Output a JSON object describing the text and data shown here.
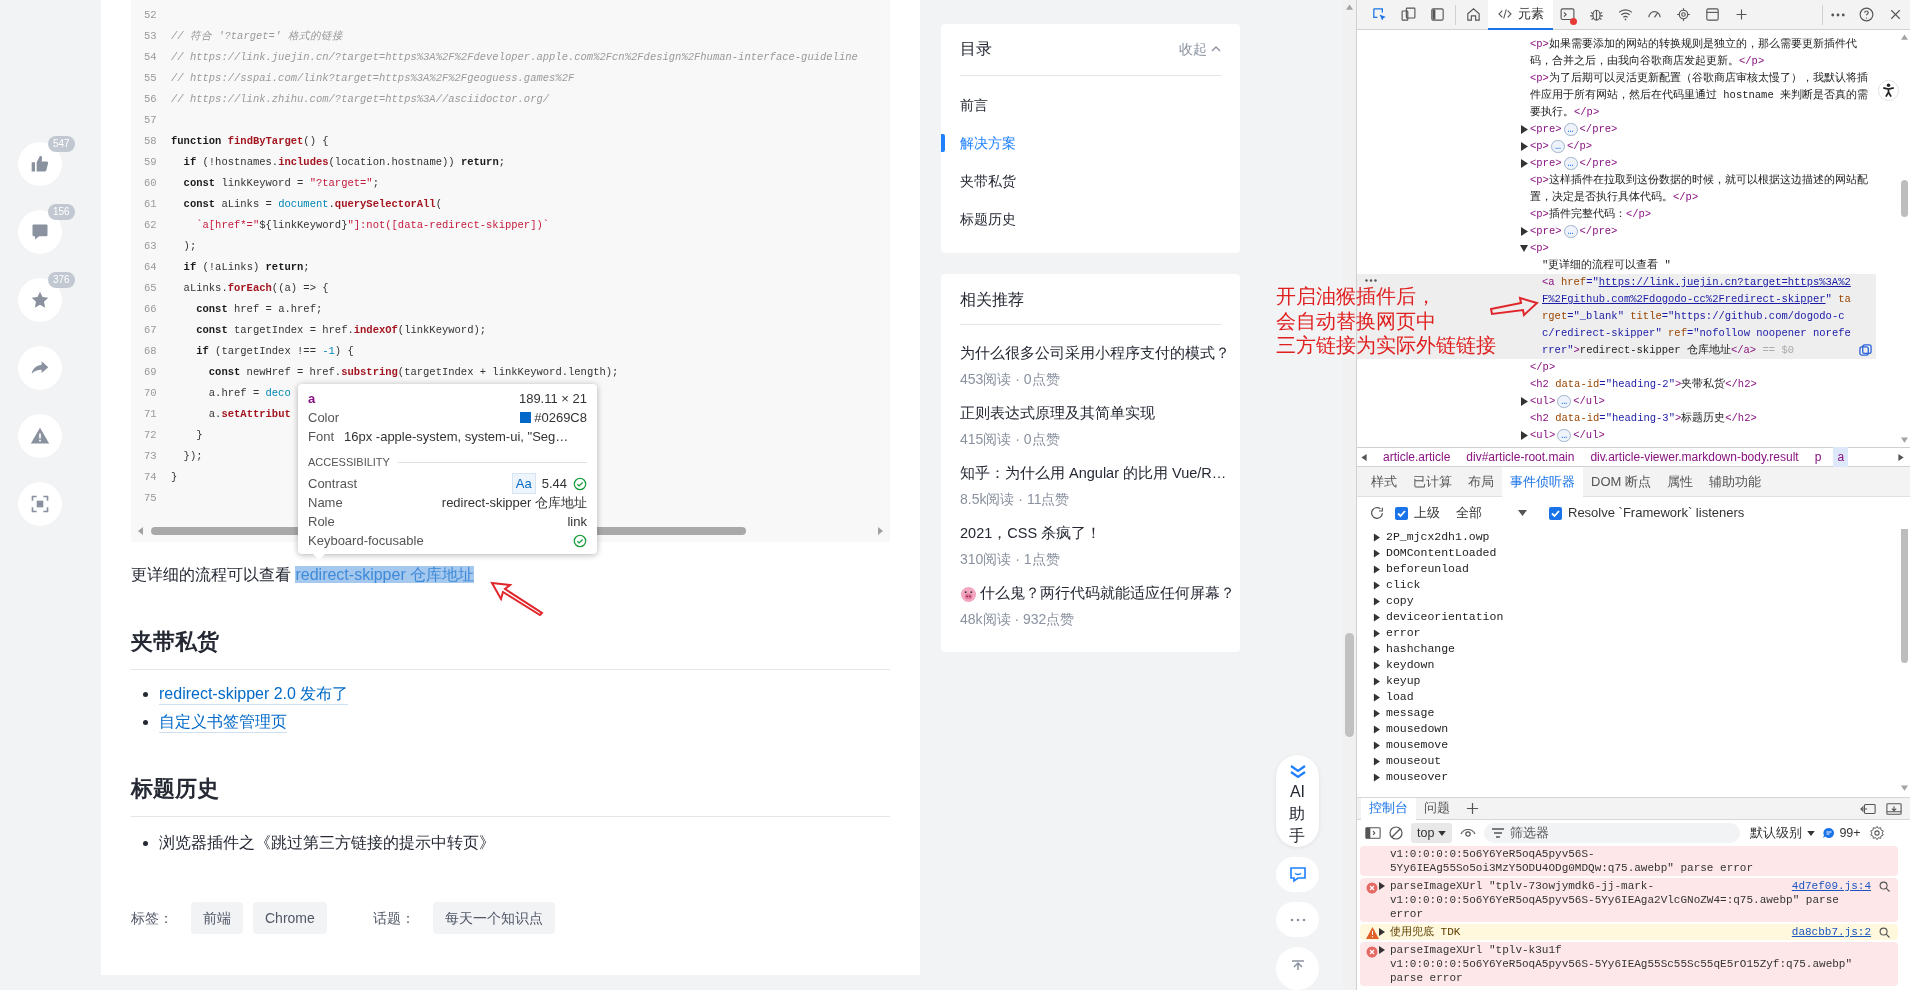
{
  "sidebar_actions": [
    {
      "kind": "like",
      "count": "547"
    },
    {
      "kind": "comment",
      "count": "156"
    },
    {
      "kind": "star",
      "count": "376"
    },
    {
      "kind": "share"
    },
    {
      "kind": "report"
    },
    {
      "kind": "fullscreen"
    }
  ],
  "code_block": {
    "lines": [
      {
        "number": "52"
      },
      {
        "number": "53",
        "tokens": [
          {
            "kind": "comment",
            "text": "// 符合 '?target=' 格式的链接"
          }
        ]
      },
      {
        "number": "54",
        "tokens": [
          {
            "kind": "comment",
            "text": "// https://link.juejin.cn/?target=https%3A%2F%2Fdeveloper.apple.com%2Fcn%2Fdesign%2Fhuman-interface-guideline"
          }
        ]
      },
      {
        "number": "55",
        "tokens": [
          {
            "kind": "comment",
            "text": "// https://sspai.com/link?target=https%3A%2F%2Fgeoguess.games%2F"
          }
        ]
      },
      {
        "number": "56",
        "tokens": [
          {
            "kind": "comment",
            "text": "// https://link.zhihu.com/?target=https%3A//asciidoctor.org/"
          }
        ]
      },
      {
        "number": "57"
      },
      {
        "number": "58",
        "tokens": [
          {
            "kind": "kw",
            "text": "function"
          },
          {
            "kind": "fn",
            "text": " findByTarget"
          },
          {
            "kind": "plain",
            "text": "() {"
          }
        ]
      },
      {
        "number": "59",
        "tokens": [
          {
            "kind": "kw",
            "text": "  if"
          },
          {
            "kind": "plain",
            "text": " (!hostnames."
          },
          {
            "kind": "fn",
            "text": "includes"
          },
          {
            "kind": "plain",
            "text": "(location.hostname)) "
          },
          {
            "kind": "kw",
            "text": "return"
          },
          {
            "kind": "plain",
            "text": ";"
          }
        ]
      },
      {
        "number": "60",
        "tokens": [
          {
            "kind": "kw",
            "text": "  const"
          },
          {
            "kind": "plain",
            "text": " linkKeyword = "
          },
          {
            "kind": "str",
            "text": "\"?target=\""
          },
          {
            "kind": "plain",
            "text": ";"
          }
        ]
      },
      {
        "number": "61",
        "tokens": [
          {
            "kind": "kw",
            "text": "  const"
          },
          {
            "kind": "plain",
            "text": " aLinks = "
          },
          {
            "kind": "builtin",
            "text": "document"
          },
          {
            "kind": "plain",
            "text": "."
          },
          {
            "kind": "fn",
            "text": "querySelectorAll"
          },
          {
            "kind": "plain",
            "text": "("
          }
        ]
      },
      {
        "number": "62",
        "tokens": [
          {
            "kind": "str",
            "text": "    `a[href*=\""
          },
          {
            "kind": "plain",
            "text": "${linkKeyword}"
          },
          {
            "kind": "str",
            "text": "\"]:not([data-redirect-skipper])`"
          }
        ]
      },
      {
        "number": "63",
        "tokens": [
          {
            "kind": "plain",
            "text": "  );"
          }
        ]
      },
      {
        "number": "64",
        "tokens": [
          {
            "kind": "kw",
            "text": "  if"
          },
          {
            "kind": "plain",
            "text": " (!aLinks) "
          },
          {
            "kind": "kw",
            "text": "return"
          },
          {
            "kind": "plain",
            "text": ";"
          }
        ]
      },
      {
        "number": "65",
        "tokens": [
          {
            "kind": "plain",
            "text": "  aLinks."
          },
          {
            "kind": "fn",
            "text": "forEach"
          },
          {
            "kind": "plain",
            "text": "((a) => {"
          }
        ]
      },
      {
        "number": "66",
        "tokens": [
          {
            "kind": "kw",
            "text": "    const"
          },
          {
            "kind": "plain",
            "text": " href = a.href;"
          }
        ]
      },
      {
        "number": "67",
        "tokens": [
          {
            "kind": "kw",
            "text": "    const"
          },
          {
            "kind": "plain",
            "text": " targetIndex = href."
          },
          {
            "kind": "fn",
            "text": "indexOf"
          },
          {
            "kind": "plain",
            "text": "(linkKeyword);"
          }
        ]
      },
      {
        "number": "68",
        "tokens": [
          {
            "kind": "kw",
            "text": "    if"
          },
          {
            "kind": "plain",
            "text": " (targetIndex !== "
          },
          {
            "kind": "builtin",
            "text": "-1"
          },
          {
            "kind": "plain",
            "text": ") {"
          }
        ]
      },
      {
        "number": "69",
        "tokens": [
          {
            "kind": "kw",
            "text": "      const"
          },
          {
            "kind": "plain",
            "text": " newHref = href."
          },
          {
            "kind": "fn",
            "text": "substring"
          },
          {
            "kind": "plain",
            "text": "(targetIndex + linkKeyword.length);"
          }
        ]
      },
      {
        "number": "70",
        "tokens": [
          {
            "kind": "plain",
            "text": "      a.href = "
          },
          {
            "kind": "builtin",
            "text": "deco"
          }
        ]
      },
      {
        "number": "71",
        "tokens": [
          {
            "kind": "plain",
            "text": "      a."
          },
          {
            "kind": "fn",
            "text": "setAttribut"
          }
        ]
      },
      {
        "number": "72",
        "tokens": [
          {
            "kind": "plain",
            "text": "    }"
          }
        ]
      },
      {
        "number": "73",
        "tokens": [
          {
            "kind": "plain",
            "text": "  });"
          }
        ]
      },
      {
        "number": "74",
        "tokens": [
          {
            "kind": "plain",
            "text": "}"
          }
        ]
      },
      {
        "number": "75"
      }
    ]
  },
  "inspect_tooltip": {
    "tag": "a",
    "size": "189.11 × 21",
    "color_label": "Color",
    "color_value": "#0269C8",
    "font_label": "Font",
    "font_value": "16px -apple-system, system-ui, \"Seg…",
    "section": "ACCESSIBILITY",
    "contrast_label": "Contrast",
    "contrast_sample": "Aa",
    "contrast_value": "5.44",
    "contrast_pass": true,
    "name_label": "Name",
    "name_value": "redirect-skipper 仓库地址",
    "role_label": "Role",
    "role_value": "link",
    "focus_label": "Keyboard-focusable",
    "focusable": true
  },
  "article": {
    "paragraph_text": "更详细的流程可以查看 ",
    "paragraph_link": "redirect-skipper 仓库地址",
    "link_highlighted": true,
    "sections": [
      {
        "heading": "夹带私货",
        "items": [
          {
            "kind": "link",
            "text": "redirect-skipper 2.0 发布了"
          },
          {
            "kind": "link",
            "text": "自定义书签管理页"
          }
        ]
      },
      {
        "heading": "标题历史",
        "items": [
          {
            "kind": "text",
            "text": "浏览器插件之《跳过第三方链接的提示中转页》"
          }
        ]
      }
    ],
    "tags_label": "标签：",
    "tags": [
      "前端",
      "Chrome"
    ],
    "topics_label": "话题：",
    "topics": [
      "每天一个知识点"
    ]
  },
  "toc": {
    "title": "目录",
    "collapse": "收起",
    "items": [
      {
        "label": "前言",
        "selected": false
      },
      {
        "label": "解决方案",
        "selected": true
      },
      {
        "label": "夹带私货",
        "selected": false
      },
      {
        "label": "标题历史",
        "selected": false
      }
    ]
  },
  "related": {
    "title": "相关推荐",
    "items": [
      {
        "kind": "plain",
        "title": "为什么很多公司采用小程序支付的模式？",
        "stats": "453阅读 · 0点赞"
      },
      {
        "kind": "plain",
        "title": "正则表达式原理及其简单实现",
        "stats": "415阅读 · 0点赞"
      },
      {
        "kind": "plain",
        "title": "知乎：为什么用 Angular 的比用 Vue/R…",
        "stats": "8.5k阅读 · 11点赞"
      },
      {
        "kind": "plain",
        "title": "2021，CSS 杀疯了！",
        "stats": "310阅读 · 1点赞"
      },
      {
        "kind": "with-icon",
        "title": "什么鬼？两行代码就能适应任何屏幕？",
        "stats": "48k阅读 · 932点赞"
      }
    ]
  },
  "floating": {
    "ai_label": "AI助手"
  },
  "annotation": {
    "lines": [
      "开启油猴插件后，",
      "会自动替换网页中",
      "三方链接为实际外链链接"
    ]
  },
  "devtools": {
    "toolbar": {
      "inspect_active": true,
      "elements_tab": {
        "label": "元素",
        "selected": true
      },
      "console_error_badge": true
    },
    "dom_tree": [
      {
        "selected": false,
        "tokens": [
          {
            "kind": "tag",
            "text": "<p>"
          },
          {
            "kind": "text",
            "text": "如果需要添加的网站的转换规则是独立的，那么需要更新插件代码，合并之后，由我向谷歌商店发起更新。"
          },
          {
            "kind": "tag",
            "text": "</p>"
          }
        ]
      },
      {
        "selected": false,
        "tokens": [
          {
            "kind": "tag",
            "text": "<p>"
          },
          {
            "kind": "text",
            "text": "为了后期可以灵活更新配置（谷歌商店审核太慢了），我默认将插件应用于所有网站，然后在代码里通过 hostname 来判断是否真的需要执行。"
          },
          {
            "kind": "tag",
            "text": "</p>"
          }
        ]
      },
      {
        "expanded": false,
        "selected": false,
        "tokens": [
          {
            "kind": "tag",
            "text": "<pre>"
          },
          {
            "kind": "ellipsis",
            "text": "…"
          },
          {
            "kind": "tag",
            "text": "</pre>"
          }
        ]
      },
      {
        "expanded": false,
        "selected": false,
        "tokens": [
          {
            "kind": "tag",
            "text": "<p>"
          },
          {
            "kind": "ellipsis",
            "text": "…"
          },
          {
            "kind": "tag",
            "text": "</p>"
          }
        ]
      },
      {
        "expanded": false,
        "selected": false,
        "tokens": [
          {
            "kind": "tag",
            "text": "<pre>"
          },
          {
            "kind": "ellipsis",
            "text": "…"
          },
          {
            "kind": "tag",
            "text": "</pre>"
          }
        ]
      },
      {
        "selected": false,
        "tokens": [
          {
            "kind": "tag",
            "text": "<p>"
          },
          {
            "kind": "text",
            "text": "这样插件在拉取到这份数据的时候，就可以根据这边描述的网站配置，决定是否执行具体代码。"
          },
          {
            "kind": "tag",
            "text": "</p>"
          }
        ]
      },
      {
        "selected": false,
        "tokens": [
          {
            "kind": "tag",
            "text": "<p>"
          },
          {
            "kind": "text",
            "text": "插件完整代码："
          },
          {
            "kind": "tag",
            "text": "</p>"
          }
        ]
      },
      {
        "expanded": false,
        "selected": false,
        "tokens": [
          {
            "kind": "tag",
            "text": "<pre>"
          },
          {
            "kind": "ellipsis",
            "text": "…"
          },
          {
            "kind": "tag",
            "text": "</pre>"
          }
        ]
      },
      {
        "expanded": true,
        "selected": false,
        "tokens": [
          {
            "kind": "tag",
            "text": "<p>"
          }
        ],
        "children": [
          {
            "selected": false,
            "tokens": [
              {
                "kind": "text",
                "text": "\"更详细的流程可以查看 \""
              }
            ]
          },
          {
            "selected": true,
            "tokens": [
              {
                "kind": "tag",
                "text": "<a"
              },
              {
                "kind": "attr",
                "text": " href"
              },
              {
                "kind": "value",
                "text": "=\""
              },
              {
                "kind": "link",
                "text": "https://link.juejin.cn?target=https%3A%2F%2Fgithub.com%2Fdogodo-cc%2Fredirect-skipper"
              },
              {
                "kind": "value",
                "text": "\""
              },
              {
                "kind": "attr",
                "text": " target"
              },
              {
                "kind": "value",
                "text": "=\"_blank\""
              },
              {
                "kind": "attr",
                "text": " title"
              },
              {
                "kind": "value",
                "text": "=\"https://github.com/dogodo-cc/redirect-skipper\""
              },
              {
                "kind": "attr",
                "text": " ref"
              },
              {
                "kind": "value",
                "text": "=\"nofollow noopener noreferrer\""
              },
              {
                "kind": "tag",
                "text": ">"
              },
              {
                "kind": "text",
                "text": "redirect-skipper 仓库地址"
              },
              {
                "kind": "tag",
                "text": "</a>"
              },
              {
                "kind": "dim",
                "text": " == $0"
              }
            ]
          }
        ]
      },
      {
        "selected": false,
        "tokens": [
          {
            "kind": "tag",
            "text": "</p>"
          }
        ]
      },
      {
        "selected": false,
        "tokens": [
          {
            "kind": "tag",
            "text": "<h2"
          },
          {
            "kind": "attr",
            "text": " data-id"
          },
          {
            "kind": "value",
            "text": "=\"heading-2\""
          },
          {
            "kind": "tag",
            "text": ">"
          },
          {
            "kind": "text",
            "text": "夹带私货"
          },
          {
            "kind": "tag",
            "text": "</h2>"
          }
        ]
      },
      {
        "expanded": false,
        "selected": false,
        "tokens": [
          {
            "kind": "tag",
            "text": "<ul>"
          },
          {
            "kind": "ellipsis",
            "text": "…"
          },
          {
            "kind": "tag",
            "text": "</ul>"
          }
        ]
      },
      {
        "selected": false,
        "tokens": [
          {
            "kind": "tag",
            "text": "<h2"
          },
          {
            "kind": "attr",
            "text": " data-id"
          },
          {
            "kind": "value",
            "text": "=\"heading-3\""
          },
          {
            "kind": "tag",
            "text": ">"
          },
          {
            "kind": "text",
            "text": "标题历史"
          },
          {
            "kind": "tag",
            "text": "</h2>"
          }
        ]
      },
      {
        "expanded": false,
        "selected": false,
        "tokens": [
          {
            "kind": "tag",
            "text": "<ul>"
          },
          {
            "kind": "ellipsis",
            "text": "…"
          },
          {
            "kind": "tag",
            "text": "</ul>"
          }
        ]
      }
    ],
    "breadcrumb": [
      {
        "label": "article.article",
        "selected": false
      },
      {
        "label": "div#article-root.main",
        "selected": false
      },
      {
        "label": "div.article-viewer.markdown-body.result",
        "selected": false
      },
      {
        "label": "p",
        "selected": false
      },
      {
        "label": "a",
        "selected": true
      }
    ],
    "panel_tabs": [
      {
        "label": "样式",
        "selected": false
      },
      {
        "label": "已计算",
        "selected": false
      },
      {
        "label": "布局",
        "selected": false
      },
      {
        "label": "事件侦听器",
        "selected": true
      },
      {
        "label": "DOM 断点",
        "selected": false
      },
      {
        "label": "属性",
        "selected": false
      },
      {
        "label": "辅助功能",
        "selected": false
      }
    ],
    "listener_options": {
      "ancestors": {
        "label": "上级",
        "checked": true
      },
      "scope": "全部",
      "resolve": {
        "label": "Resolve `Framework` listeners",
        "checked": true
      }
    },
    "listeners": [
      {
        "name": "2P_mjcx2dh1.owp",
        "expanded": false
      },
      {
        "name": "DOMContentLoaded",
        "expanded": false
      },
      {
        "name": "beforeunload",
        "expanded": false
      },
      {
        "name": "click",
        "expanded": false
      },
      {
        "name": "copy",
        "expanded": false
      },
      {
        "name": "deviceorientation",
        "expanded": false
      },
      {
        "name": "error",
        "expanded": false
      },
      {
        "name": "hashchange",
        "expanded": false
      },
      {
        "name": "keydown",
        "expanded": false
      },
      {
        "name": "keyup",
        "expanded": false
      },
      {
        "name": "load",
        "expanded": false
      },
      {
        "name": "message",
        "expanded": false
      },
      {
        "name": "mousedown",
        "expanded": false
      },
      {
        "name": "mousemove",
        "expanded": false
      },
      {
        "name": "mouseout",
        "expanded": false
      },
      {
        "name": "mouseover",
        "expanded": false
      }
    ],
    "drawer_tabs": [
      {
        "label": "控制台",
        "selected": true
      },
      {
        "label": "问题",
        "selected": false
      }
    ],
    "console_toolbar": {
      "context": "top",
      "filter_placeholder": "筛选器",
      "level": "默认级别",
      "message_count": "99+"
    },
    "messages": [
      {
        "kind": "error",
        "continued": true,
        "lines": [
          "v1:0:0:0:0:5o6Y6YeR5oqA5pyv56S-",
          "5Yy6IEAg55So5oi3MzY5ODU4ODg0MDQw:q75.awebp\" parse error"
        ]
      },
      {
        "kind": "error",
        "continued": false,
        "source": "4d7ef09.js:4",
        "lines": [
          "parseImageXUrl \"tplv-73owjymdk6-jj-mark-",
          "v1:0:0:0:0:5o6Y6YeR5oqA5pyv56S-5Yy6IEAga2VlcGNoZW4=:q75.awebp\" parse",
          "error"
        ]
      },
      {
        "kind": "warning",
        "continued": false,
        "source": "da8cbb7.js:2",
        "lines": [
          "使用兜底 TDK"
        ]
      },
      {
        "kind": "error",
        "continued": false,
        "lines": [
          "parseImageXUrl \"tplv-k3u1f",
          "v1:0:0:0:0:5o6Y6YeR5oqA5pyv56S-5Yy6IEAg55Sc55Sc55qE5rO15Zyf:q75.awebp\"",
          "parse error"
        ]
      }
    ]
  }
}
